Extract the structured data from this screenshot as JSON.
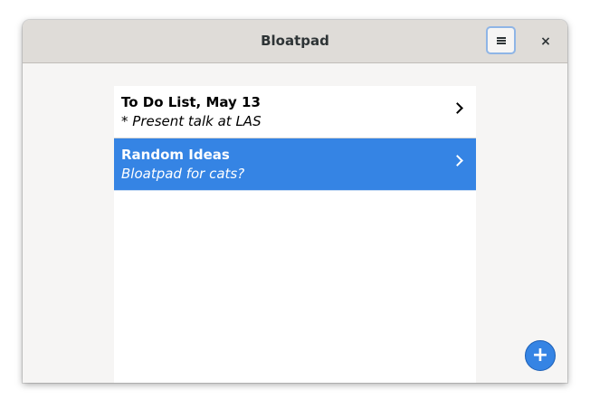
{
  "window": {
    "title": "Bloatpad",
    "menu_icon": "hamburger-menu-icon",
    "close_label": "×"
  },
  "notes": [
    {
      "title": "To Do List, May 13",
      "subtitle": "* Present talk at LAS",
      "selected": false
    },
    {
      "title": "Random Ideas",
      "subtitle": "Bloatpad for cats?",
      "selected": true
    }
  ],
  "fab": {
    "label": "+"
  },
  "colors": {
    "accent": "#3584e4",
    "header": "#dfdcd8",
    "background": "#f6f5f4"
  }
}
